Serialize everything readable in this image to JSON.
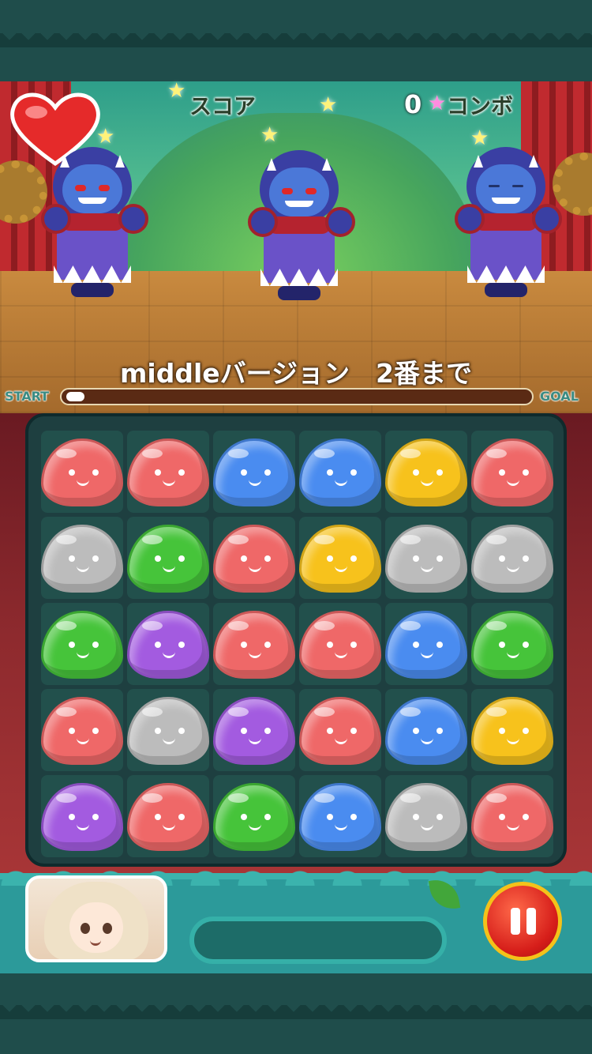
{
  "hud": {
    "score_label": "スコア",
    "combo_value": "0",
    "combo_label": "コンボ"
  },
  "stage": {
    "title": "middleバージョン　2番まで"
  },
  "progress": {
    "start_label": "START",
    "goal_label": "GOAL",
    "value": 0.04
  },
  "colors": {
    "red": "#ef6868",
    "blue": "#4a8cf0",
    "yellow": "#f7c21c",
    "gray": "#bcbcbc",
    "green": "#46c43a",
    "purple": "#a35be0"
  },
  "board": {
    "rows": [
      [
        "red",
        "red",
        "blue",
        "blue",
        "yellow",
        "red"
      ],
      [
        "gray",
        "green",
        "red",
        "yellow",
        "gray",
        "gray"
      ],
      [
        "green",
        "purple",
        "red",
        "red",
        "blue",
        "green"
      ],
      [
        "red",
        "gray",
        "purple",
        "red",
        "blue",
        "yellow"
      ],
      [
        "purple",
        "red",
        "green",
        "blue",
        "gray",
        "red"
      ]
    ]
  },
  "skill": {
    "gauge_value": 0
  },
  "icons": {
    "pause": "pause-icon",
    "life": "heart-icon",
    "leader": "character-avatar-icon"
  }
}
